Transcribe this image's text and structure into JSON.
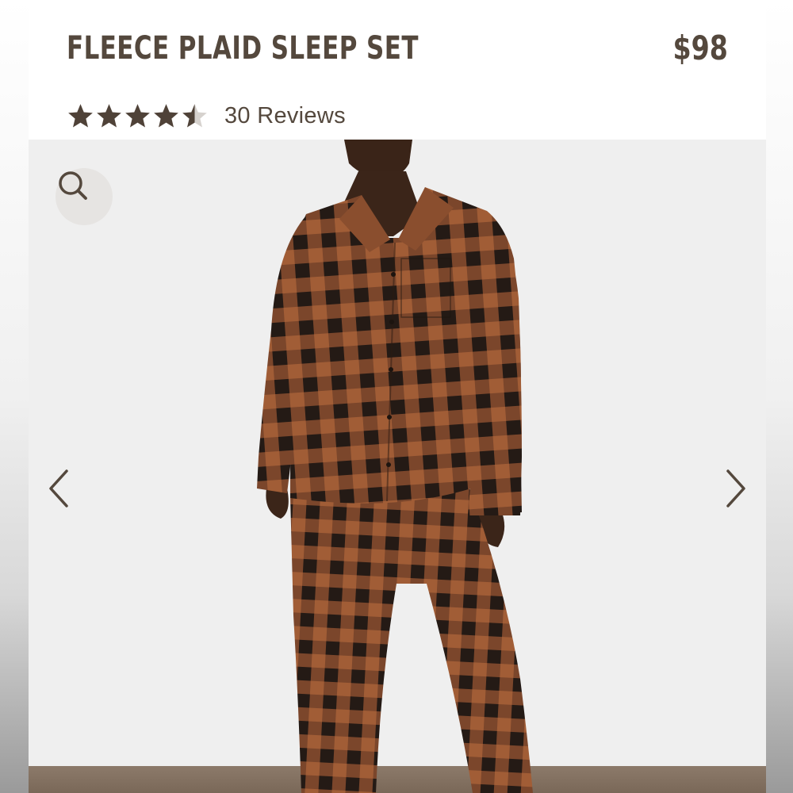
{
  "product": {
    "title": "FLEECE PLAID SLEEP SET",
    "price": "$98",
    "rating": 4.5,
    "rating_max": 5,
    "reviews_label": "30 Reviews"
  },
  "gallery": {
    "zoom_icon": "search-icon",
    "prev_icon": "chevron-left-icon",
    "next_icon": "chevron-right-icon"
  },
  "colors": {
    "text": "#54483d",
    "star": "#4f4238",
    "plaid_rust": "#9c5a35",
    "plaid_dark": "#2a201a"
  }
}
